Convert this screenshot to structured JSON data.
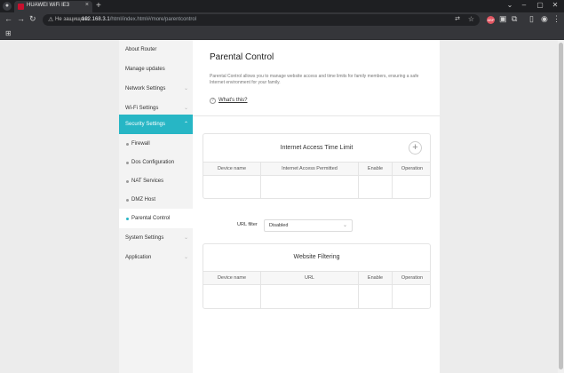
{
  "browser": {
    "tab_title": "HUAWEI WiFi IE3",
    "tab_close": "×",
    "new_tab": "+",
    "secure_label": "Не защищено",
    "url_host": "192.168.3.1",
    "url_path": "/html/index.html#/more/parentcontrol",
    "window_controls": [
      "⌄",
      "–",
      "▢",
      "✕"
    ],
    "ext_badge": "ABP"
  },
  "sidebar": {
    "items": [
      {
        "label": "About Router"
      },
      {
        "label": "Manage updates"
      },
      {
        "label": "Network Settings"
      },
      {
        "label": "Wi-Fi Settings"
      },
      {
        "label": "Security Settings"
      },
      {
        "label": "Firewall"
      },
      {
        "label": "Dos Configuration"
      },
      {
        "label": "NAT Services"
      },
      {
        "label": "DMZ Host"
      },
      {
        "label": "Parental Control"
      },
      {
        "label": "System Settings"
      },
      {
        "label": "Application"
      }
    ]
  },
  "main": {
    "title": "Parental Control",
    "description": "Parental Control allows you to manage website access and time limits for family members, ensuring a safe Internet environment for your family.",
    "help_icon": "?",
    "help_link": "What's this?",
    "time_limit": {
      "title": "Internet Access Time Limit",
      "add": "+",
      "columns": [
        "Device name",
        "Internet Access Permitted",
        "Enable",
        "Operation"
      ]
    },
    "url_filter": {
      "label": "URL filter",
      "value": "Disabled"
    },
    "website_filtering": {
      "title": "Website Filtering",
      "columns": [
        "Device name",
        "URL",
        "Enable",
        "Operation"
      ]
    }
  },
  "colors": {
    "accent": "#27b6c5",
    "sidebar_bg": "#f3f3f3",
    "chrome_dark": "#35363a"
  }
}
